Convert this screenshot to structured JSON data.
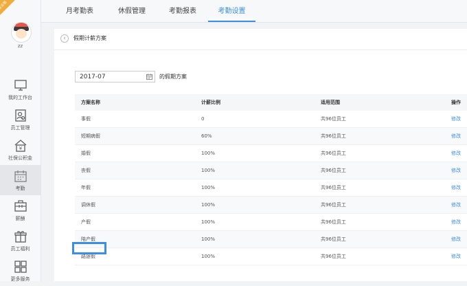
{
  "sidebar": {
    "corner_badge": "企业版",
    "username": "zz",
    "items": [
      {
        "label": "我的工作台",
        "icon": "monitor-icon"
      },
      {
        "label": "员工管理",
        "icon": "employee-icon"
      },
      {
        "label": "社保公积金",
        "icon": "social-security-icon"
      },
      {
        "label": "考勤",
        "icon": "calendar-icon"
      },
      {
        "label": "薪酬",
        "icon": "salary-icon"
      },
      {
        "label": "员工福利",
        "icon": "gift-icon"
      },
      {
        "label": "更多服务",
        "icon": "grid-icon"
      }
    ]
  },
  "tabs": [
    {
      "label": "月考勤表"
    },
    {
      "label": "休假管理"
    },
    {
      "label": "考勤报表"
    },
    {
      "label": "考勤设置"
    }
  ],
  "panel": {
    "title": "假期计薪方案",
    "month_value": "2017-07",
    "month_suffix": "的假期方案"
  },
  "table": {
    "headers": [
      "方案名称",
      "计薪比例",
      "适用范围",
      "操作"
    ],
    "rows": [
      {
        "name": "事假",
        "ratio": "0",
        "scope": "共96位员工",
        "action": "修改"
      },
      {
        "name": "短期病假",
        "ratio": "60%",
        "scope": "共96位员工",
        "action": "修改"
      },
      {
        "name": "婚假",
        "ratio": "100%",
        "scope": "共96位员工",
        "action": "修改"
      },
      {
        "name": "丧假",
        "ratio": "100%",
        "scope": "共96位员工",
        "action": "修改"
      },
      {
        "name": "年假",
        "ratio": "100%",
        "scope": "共96位员工",
        "action": "修改"
      },
      {
        "name": "调休假",
        "ratio": "100%",
        "scope": "共96位员工",
        "action": "修改"
      },
      {
        "name": "产假",
        "ratio": "100%",
        "scope": "共96位员工",
        "action": "修改"
      },
      {
        "name": "陪产假",
        "ratio": "100%",
        "scope": "共96位员工",
        "action": "修改"
      },
      {
        "name": "路途假",
        "ratio": "100%",
        "scope": "共96位员工",
        "action": "修改"
      }
    ]
  },
  "colors": {
    "accent": "#3a8ee6",
    "badge": "#f0ac3d"
  }
}
